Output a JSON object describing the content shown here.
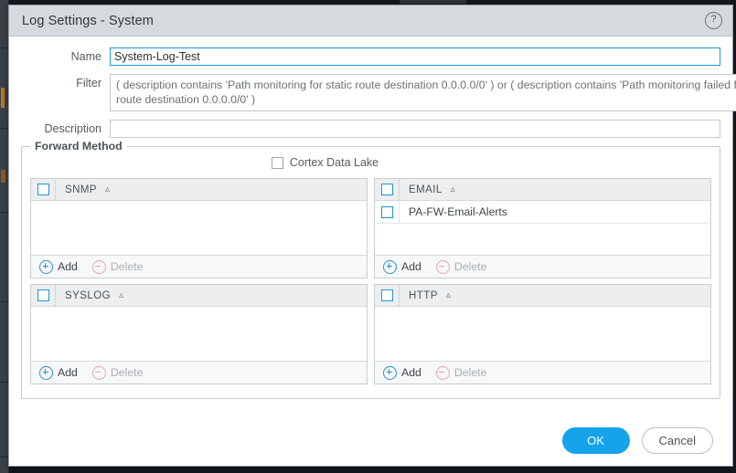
{
  "window": {
    "title": "Log Settings - System",
    "help_icon": "help-circle-icon"
  },
  "form": {
    "name": {
      "label": "Name",
      "value": "System-Log-Test",
      "placeholder": ""
    },
    "filter": {
      "label": "Filter",
      "line1": "( description contains 'Path monitoring for static route destination 0.0.0.0/0' ) or ( description contains 'Path monitoring failed for static",
      "line2": "route destination 0.0.0.0/0' )",
      "caret_icon": "chevron-down-icon"
    },
    "description": {
      "label": "Description",
      "value": "",
      "placeholder": ""
    }
  },
  "forward_method": {
    "legend": "Forward Method",
    "cortex_data_lake": {
      "label": "Cortex Data Lake",
      "checked": false
    },
    "panels": [
      {
        "id": "snmp",
        "title": "SNMP",
        "checked": false,
        "collapse_icon": "chevron-up-icon",
        "rows": [],
        "footer": {
          "add_label": "Add",
          "add_icon": "plus-circle-icon",
          "delete_label": "Delete",
          "delete_icon": "minus-circle-icon",
          "delete_disabled": true
        }
      },
      {
        "id": "email",
        "title": "EMAIL",
        "checked": false,
        "collapse_icon": "chevron-up-icon",
        "rows": [
          {
            "label": "PA-FW-Email-Alerts",
            "checked": false
          }
        ],
        "footer": {
          "add_label": "Add",
          "add_icon": "plus-circle-icon",
          "delete_label": "Delete",
          "delete_icon": "minus-circle-icon",
          "delete_disabled": true
        }
      },
      {
        "id": "syslog",
        "title": "SYSLOG",
        "checked": false,
        "collapse_icon": "chevron-up-icon",
        "rows": [],
        "footer": {
          "add_label": "Add",
          "add_icon": "plus-circle-icon",
          "delete_label": "Delete",
          "delete_icon": "minus-circle-icon",
          "delete_disabled": true
        }
      },
      {
        "id": "http",
        "title": "HTTP",
        "checked": false,
        "collapse_icon": "chevron-up-icon",
        "rows": [],
        "footer": {
          "add_label": "Add",
          "add_icon": "plus-circle-icon",
          "delete_label": "Delete",
          "delete_icon": "minus-circle-icon",
          "delete_disabled": true
        }
      }
    ]
  },
  "footer": {
    "ok_label": "OK",
    "cancel_label": "Cancel"
  },
  "colors": {
    "accent_blue": "#15a3ea",
    "checkbox_blue": "#2196d9",
    "titlebar": "#d6dade",
    "delete_red": "#e8a3a8"
  }
}
